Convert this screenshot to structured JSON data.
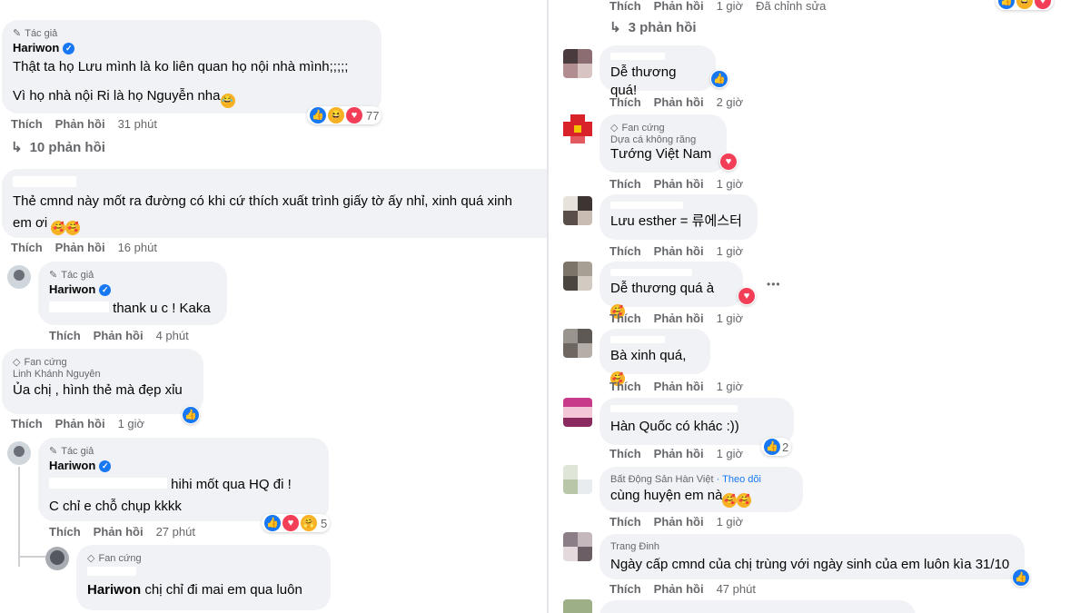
{
  "left": {
    "c1": {
      "badge": "Tác giả",
      "name": "Hariwon",
      "line1": "Thật ta họ Lưu mình là ko liên quan họ nội nhà mình;;;;;",
      "line2": "Vì họ nhà nội Ri là họ Nguyễn nha",
      "like": "Thích",
      "reply": "Phản hồi",
      "time": "31 phút",
      "react_count": "77",
      "replies_label": "10 phản hồi"
    },
    "c2": {
      "line1": "Thẻ cmnd này mốt ra đường có khi cứ thích xuất trình giấy tờ ấy nhỉ, xinh quá xinh",
      "line2": "em ơi",
      "like": "Thích",
      "reply": "Phản hồi",
      "time": "16 phút"
    },
    "c3": {
      "badge": "Tác giả",
      "name": "Hariwon",
      "text": "thank u c ! Kaka",
      "like": "Thích",
      "reply": "Phản hồi",
      "time": "4 phút"
    },
    "c4": {
      "badge": "Fan cứng",
      "partial_name": "Linh Khánh Nguyễn",
      "text": "Ủa chị , hình thẻ mà đẹp xỉu",
      "like": "Thích",
      "reply": "Phản hồi",
      "time": "1 giờ"
    },
    "c5": {
      "badge": "Tác giả",
      "name": "Hariwon",
      "line1": "hihi mốt qua HQ đi !",
      "line2": "C chỉ e chỗ chụp kkkk",
      "like": "Thích",
      "reply": "Phản hồi",
      "time": "27 phút",
      "react_count": "5"
    },
    "c6": {
      "badge": "Fan cứng",
      "mention": "Hariwon",
      "text": "chị chỉ đi mai em qua luôn"
    }
  },
  "right": {
    "top": {
      "like": "Thích",
      "reply": "Phản hồi",
      "time": "1 giờ",
      "edited": "Đã chỉnh sửa",
      "replies_label": "3 phản hồi"
    },
    "items": [
      {
        "text": "Dễ thương quá!",
        "time": "2 giờ"
      },
      {
        "badge": "Fan cứng",
        "partial_name": "Dựa cá không răng",
        "text": "Tướng Việt Nam",
        "time": "1 giờ"
      },
      {
        "text": "Lưu esther = 류에스터",
        "time": "1 giờ"
      },
      {
        "text": "Dễ thương quá à",
        "time": "1 giờ",
        "more": "•••"
      },
      {
        "text": "Bà xinh quá,",
        "time": "1 giờ"
      },
      {
        "text": "Hàn Quốc có khác :))",
        "time": "1 giờ",
        "react_count": "2"
      },
      {
        "partial_name": "Bất Động Sản Hàn Việt",
        "follow": "· Theo dõi",
        "text": "cùng huyện em nà",
        "time": "1 giờ"
      },
      {
        "partial_name": "Trang Đinh",
        "text": "Ngày cấp cmnd của chị trùng với ngày sinh của em luôn kìa 31/10",
        "time": "47 phút"
      }
    ],
    "like": "Thích",
    "reply": "Phản hồi"
  },
  "colors": {
    "facebook_blue": "#1877f2",
    "bubble": "#f0f2f5",
    "meta_text": "#65676b"
  },
  "icons": [
    "pencil-icon",
    "verified-badge-icon",
    "diamond-icon",
    "reply-arrow-icon",
    "like-react-icon",
    "love-react-icon",
    "haha-react-icon",
    "care-react-icon",
    "more-icon"
  ]
}
